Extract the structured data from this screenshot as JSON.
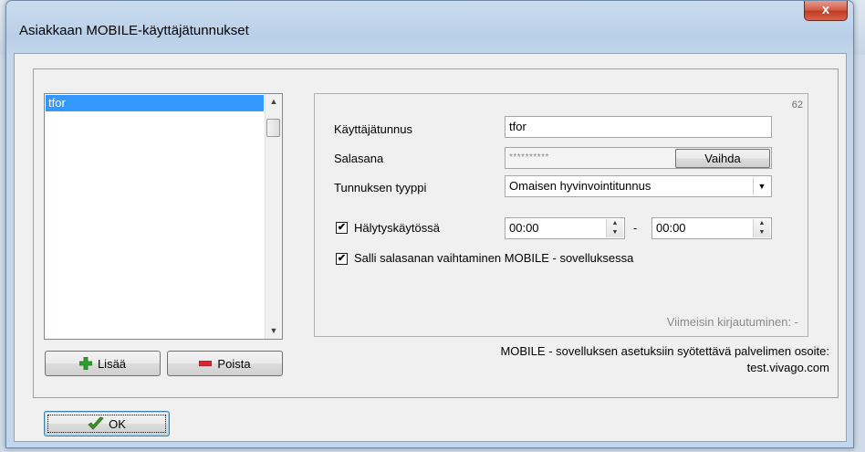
{
  "window": {
    "title": "Asiakkaan MOBILE-käyttäjätunnukset",
    "close_label": "x"
  },
  "users": {
    "items": [
      "tfor"
    ]
  },
  "buttons": {
    "add_label": "Lisää",
    "remove_label": "Poista",
    "ok_label": "OK",
    "change_password_label": "Vaihda"
  },
  "form": {
    "id_code": "62",
    "username_label": "Käyttäjätunnus",
    "username_value": "tfor",
    "password_label": "Salasana",
    "password_value": "**********",
    "type_label": "Tunnuksen tyyppi",
    "type_value": "Omaisen hyvinvointitunnus",
    "alarm_label": "Hälytyskäytössä",
    "alarm_checked": true,
    "alarm_start": "00:00",
    "alarm_separator": "-",
    "alarm_end": "00:00",
    "allow_change_label": "Salli salasanan vaihtaminen MOBILE - sovelluksessa",
    "allow_change_checked": true,
    "last_login": "Viimeisin kirjautuminen: -"
  },
  "server": {
    "label": "MOBILE - sovelluksen asetuksiin syötettävä palvelimen osoite:",
    "address": "test.vivago.com"
  },
  "icons": {
    "add": "plus-icon",
    "remove": "minus-icon",
    "ok": "checkmark-icon"
  },
  "colors": {
    "selection": "#3399ff",
    "add_icon": "#2ea02e",
    "remove_icon": "#d8262c",
    "ok_icon": "#3a9b1e"
  }
}
